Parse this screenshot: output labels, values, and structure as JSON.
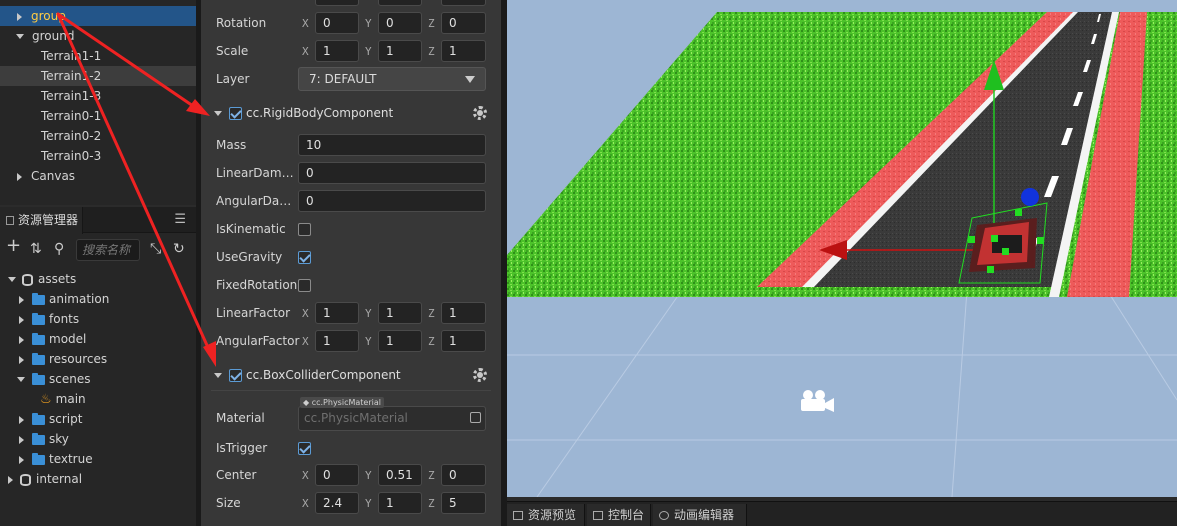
{
  "hierarchy": {
    "items": [
      {
        "label": "group",
        "expanded": false,
        "selected": true
      },
      {
        "label": "ground",
        "expanded": true
      },
      {
        "label": "Terrain1-1"
      },
      {
        "label": "Terrain1-2",
        "hovered": true
      },
      {
        "label": "Terrain1-3"
      },
      {
        "label": "Terrain0-1"
      },
      {
        "label": "Terrain0-2"
      },
      {
        "label": "Terrain0-3"
      },
      {
        "label": "Canvas",
        "expanded": false
      }
    ]
  },
  "assets_panel": {
    "title": "资源管理器",
    "search_placeholder": "搜索名称",
    "tree": [
      {
        "label": "assets",
        "icon": "database-icon",
        "expanded": true
      },
      {
        "label": "animation",
        "icon": "folder-icon"
      },
      {
        "label": "fonts",
        "icon": "folder-icon"
      },
      {
        "label": "model",
        "icon": "folder-icon"
      },
      {
        "label": "resources",
        "icon": "folder-icon"
      },
      {
        "label": "scenes",
        "icon": "folder-icon",
        "expanded": true
      },
      {
        "label": "main",
        "icon": "scene-flame-icon"
      },
      {
        "label": "script",
        "icon": "folder-icon"
      },
      {
        "label": "sky",
        "icon": "folder-icon"
      },
      {
        "label": "textrue",
        "icon": "folder-icon"
      },
      {
        "label": "internal",
        "icon": "database-icon"
      }
    ]
  },
  "inspector": {
    "rotation": {
      "label": "Rotation",
      "x": "0",
      "y": "0",
      "z": "0"
    },
    "scale": {
      "label": "Scale",
      "x": "1",
      "y": "1",
      "z": "1"
    },
    "layer": {
      "label": "Layer",
      "value": "7: DEFAULT"
    },
    "rigidbody": {
      "title": "cc.RigidBodyComponent",
      "enabled": true,
      "mass": {
        "label": "Mass",
        "value": "10"
      },
      "linear_damping": {
        "label": "LinearDam…",
        "value": "0"
      },
      "angular_damping": {
        "label": "AngularDa…",
        "value": "0"
      },
      "is_kinematic": {
        "label": "IsKinematic",
        "checked": false
      },
      "use_gravity": {
        "label": "UseGravity",
        "checked": true
      },
      "fixed_rotation": {
        "label": "FixedRotation",
        "checked": false
      },
      "linear_factor": {
        "label": "LinearFactor",
        "x": "1",
        "y": "1",
        "z": "1"
      },
      "angular_factor": {
        "label": "AngularFactor",
        "x": "1",
        "y": "1",
        "z": "1"
      }
    },
    "boxcollider": {
      "title": "cc.BoxColliderComponent",
      "enabled": true,
      "material": {
        "label": "Material",
        "tag": "cc.PhysicMaterial",
        "placeholder": "cc.PhysicMaterial"
      },
      "is_trigger": {
        "label": "IsTrigger",
        "checked": true
      },
      "center": {
        "label": "Center",
        "x": "0",
        "y": "0.51",
        "z": "0"
      },
      "size": {
        "label": "Size",
        "x": "2.4",
        "y": "1",
        "z": "5"
      }
    },
    "axis_labels": {
      "x": "X",
      "y": "Y",
      "z": "Z"
    }
  },
  "bottom_tabs": [
    {
      "label": "资源预览",
      "icon": "preview-icon"
    },
    {
      "label": "控制台",
      "icon": "console-icon"
    },
    {
      "label": "动画编辑器",
      "icon": "animation-icon"
    }
  ],
  "colors": {
    "selection_bg": "#235589",
    "selection_text": "#ffcc44",
    "annotation_arrow": "#ee2222",
    "grass": "#4cc22a",
    "bike_lane": "#ee5a5a",
    "asphalt": "#3a3a3a",
    "gizmo_green": "#22cc22",
    "gizmo_red": "#cc1111",
    "gizmo_blue": "#1133dd"
  }
}
